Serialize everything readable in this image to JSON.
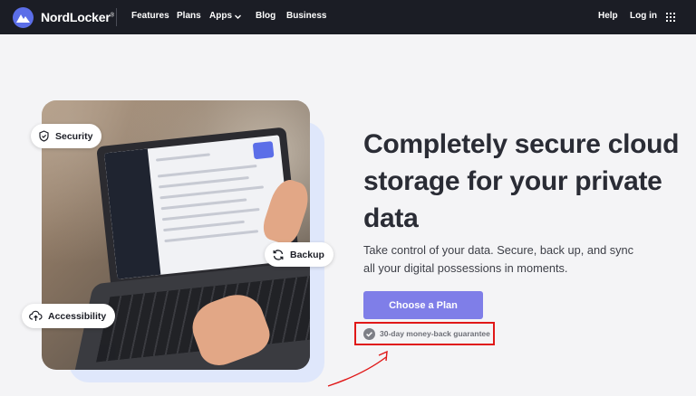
{
  "header": {
    "brand": "NordLocker",
    "brand_mark": "®",
    "nav": [
      "Features",
      "Plans",
      "Apps",
      "Blog",
      "Business"
    ],
    "help": "Help",
    "login": "Log in",
    "grid_icon": "apps-grid-icon"
  },
  "hero": {
    "badges": {
      "security": "Security",
      "backup": "Backup",
      "accessibility": "Accessibility"
    }
  },
  "main": {
    "headline": "Completely secure cloud storage for your private data",
    "subtext": "Take control of your data. Secure, back up, and sync all your digital possessions in moments.",
    "cta": "Choose a Plan",
    "guarantee": "30-day money-back guarantee"
  },
  "colors": {
    "topbar": "#1b1d25",
    "accent": "#7f7ee8",
    "annotation": "#e01818"
  }
}
